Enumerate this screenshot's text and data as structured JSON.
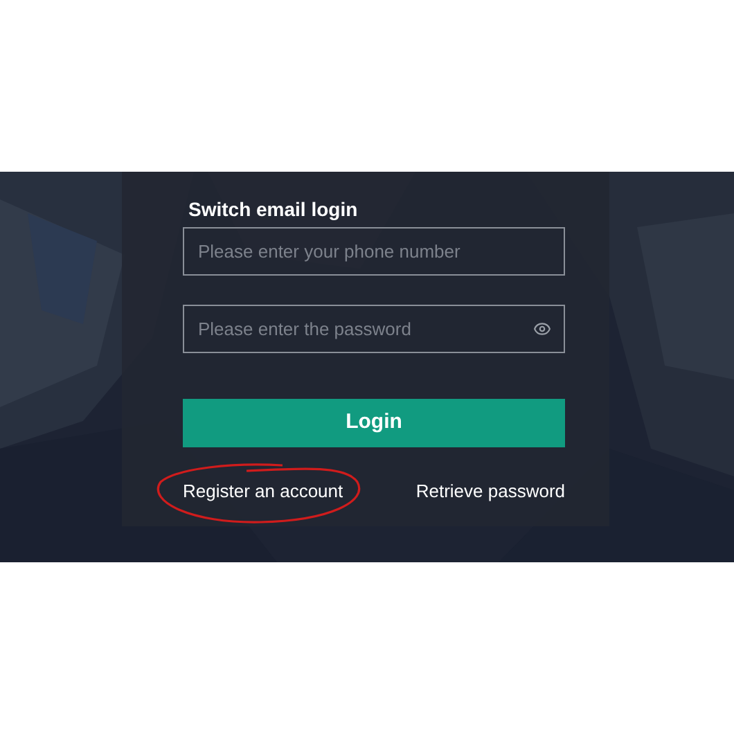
{
  "login_form": {
    "title": "Switch email login",
    "phone_field": {
      "placeholder": "Please enter your phone number"
    },
    "password_field": {
      "placeholder": "Please enter the password"
    },
    "login_button": "Login",
    "links": [
      "Register an account",
      "Retrieve password"
    ]
  },
  "annotation": {
    "kind": "circle",
    "color": "#d01c1c"
  }
}
